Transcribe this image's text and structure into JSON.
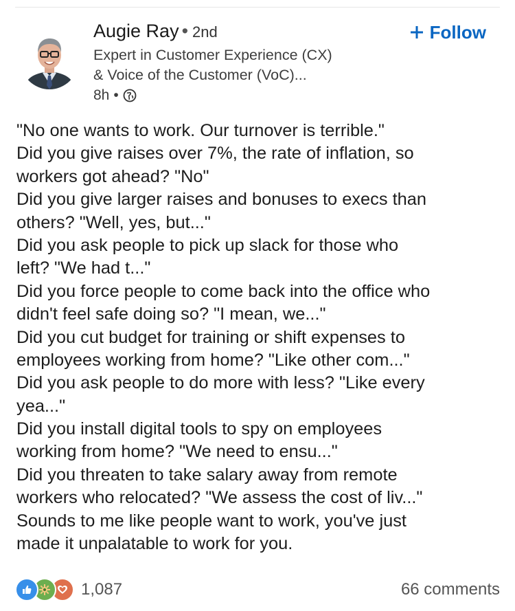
{
  "author": {
    "name": "Augie Ray",
    "separator": "•",
    "degree": "2nd",
    "headline": "Expert in Customer Experience (CX)\n& Voice of the Customer (VoC)...",
    "time": "8h",
    "time_separator": "•",
    "visibility_icon": "globe-icon",
    "avatar_icon": "person-photo"
  },
  "follow": {
    "icon": "plus-icon",
    "label": "Follow"
  },
  "post": {
    "lines": [
      "\"No one wants to work. Our turnover is terrible.\"",
      "Did you give raises over 7%, the rate of inflation, so",
      "workers got ahead? \"No\"",
      "Did you give larger raises and bonuses to execs than",
      "others? \"Well, yes, but...\"",
      "Did you ask people to pick up slack for those who",
      "left? \"We had t...\"",
      "Did you force people to come back into the office who",
      "didn't feel safe doing so? \"I mean, we...\"",
      "Did you cut budget for training or shift expenses to",
      "employees working from home? \"Like other com...\"",
      "Did you ask people to do more with less? \"Like every",
      "yea...\"",
      "Did you install digital tools to spy on employees",
      "working from home? \"We need to ensu...\"",
      "Did you threaten to take salary away from remote",
      "workers who relocated? \"We assess the cost of liv...\"",
      "Sounds to me like people want to work, you've just",
      "made it unpalatable to work for you."
    ]
  },
  "social": {
    "reaction_icons": [
      "like-icon",
      "support-icon",
      "love-icon"
    ],
    "reaction_count": "1,087",
    "comments": "66 comments"
  },
  "colors": {
    "accent": "#0a66c2",
    "like": "#378fe9",
    "support": "#6dae4f",
    "love": "#df704d",
    "text": "#1d1d1d",
    "muted": "#555555"
  }
}
